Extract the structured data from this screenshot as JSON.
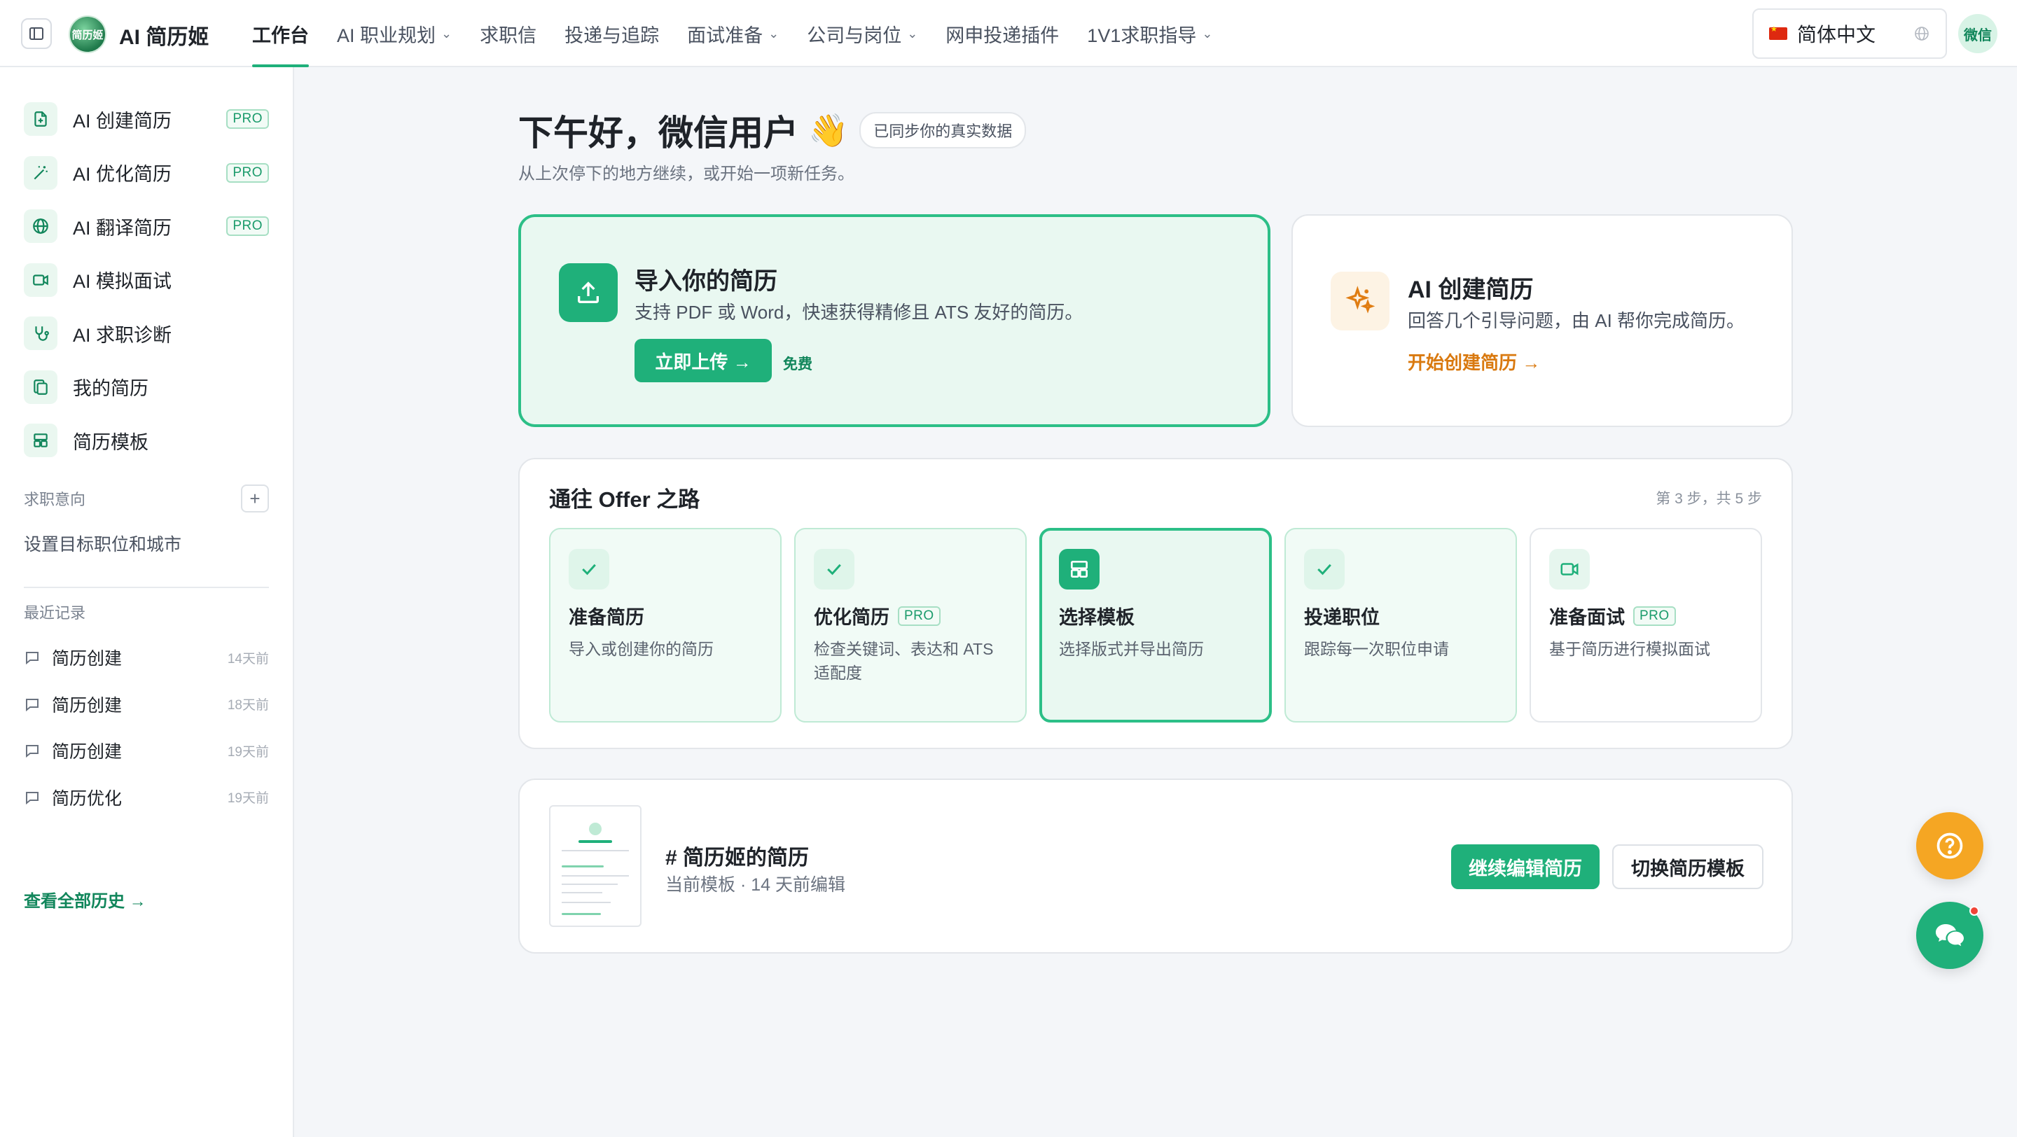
{
  "header": {
    "brand": "AI 简历姬",
    "logo_text": "简历姬",
    "nav": [
      {
        "label": "工作台",
        "active": true,
        "dropdown": false
      },
      {
        "label": "AI 职业规划",
        "active": false,
        "dropdown": true
      },
      {
        "label": "求职信",
        "active": false,
        "dropdown": false
      },
      {
        "label": "投递与追踪",
        "active": false,
        "dropdown": false
      },
      {
        "label": "面试准备",
        "active": false,
        "dropdown": true
      },
      {
        "label": "公司与岗位",
        "active": false,
        "dropdown": true
      },
      {
        "label": "网申投递插件",
        "active": false,
        "dropdown": false
      },
      {
        "label": "1V1求职指导",
        "active": false,
        "dropdown": true
      }
    ],
    "language": "简体中文",
    "avatar": "微信"
  },
  "sidebar": {
    "items": [
      {
        "label": "AI 创建简历",
        "pro": "PRO",
        "icon": "file-plus-icon"
      },
      {
        "label": "AI 优化简历",
        "pro": "PRO",
        "icon": "magic-wand-icon"
      },
      {
        "label": "AI 翻译简历",
        "pro": "PRO",
        "icon": "globe-icon"
      },
      {
        "label": "AI 模拟面试",
        "pro": "",
        "icon": "video-icon"
      },
      {
        "label": "AI 求职诊断",
        "pro": "",
        "icon": "stethoscope-icon"
      },
      {
        "label": "我的简历",
        "pro": "",
        "icon": "copy-icon"
      },
      {
        "label": "简历模板",
        "pro": "",
        "icon": "layout-icon"
      }
    ],
    "intent_title": "求职意向",
    "intent_text": "设置目标职位和城市",
    "recent_title": "最近记录",
    "history": [
      {
        "label": "简历创建",
        "time": "14天前"
      },
      {
        "label": "简历创建",
        "time": "18天前"
      },
      {
        "label": "简历创建",
        "time": "19天前"
      },
      {
        "label": "简历优化",
        "time": "19天前"
      }
    ],
    "view_all": "查看全部历史 →"
  },
  "main": {
    "greeting": "下午好，微信用户",
    "wave": "👋",
    "sync_badge": "已同步你的真实数据",
    "subtitle": "从上次停下的地方继续，或开始一项新任务。",
    "upload": {
      "title": "导入你的简历",
      "desc": "支持 PDF 或 Word，快速获得精修且 ATS 友好的简历。",
      "button": "立即上传 →",
      "free": "免费"
    },
    "ai_create": {
      "title": "AI 创建简历",
      "desc": "回答几个引导问题，由 AI 帮你完成简历。",
      "link": "开始创建简历 →"
    },
    "road": {
      "title": "通往 Offer 之路",
      "step_text": "第 3 步，共 5 步",
      "steps": [
        {
          "title": "准备简历",
          "desc": "导入或创建你的简历",
          "pro": "",
          "state": "done"
        },
        {
          "title": "优化简历",
          "desc": "检查关键词、表达和 ATS 适配度",
          "pro": "PRO",
          "state": "done"
        },
        {
          "title": "选择模板",
          "desc": "选择版式并导出简历",
          "pro": "",
          "state": "current"
        },
        {
          "title": "投递职位",
          "desc": "跟踪每一次职位申请",
          "pro": "",
          "state": "done"
        },
        {
          "title": "准备面试",
          "desc": "基于简历进行模拟面试",
          "pro": "PRO",
          "state": "todo"
        }
      ]
    },
    "resume": {
      "name": "# 简历姬的简历",
      "meta": "当前模板 · 14 天前编辑",
      "edit_button": "继续编辑简历",
      "switch_button": "切换简历模板"
    }
  },
  "colors": {
    "accent": "#1fb07a",
    "accent_dark": "#11865b",
    "orange": "#d9790f",
    "help_fab": "#f5a623"
  }
}
